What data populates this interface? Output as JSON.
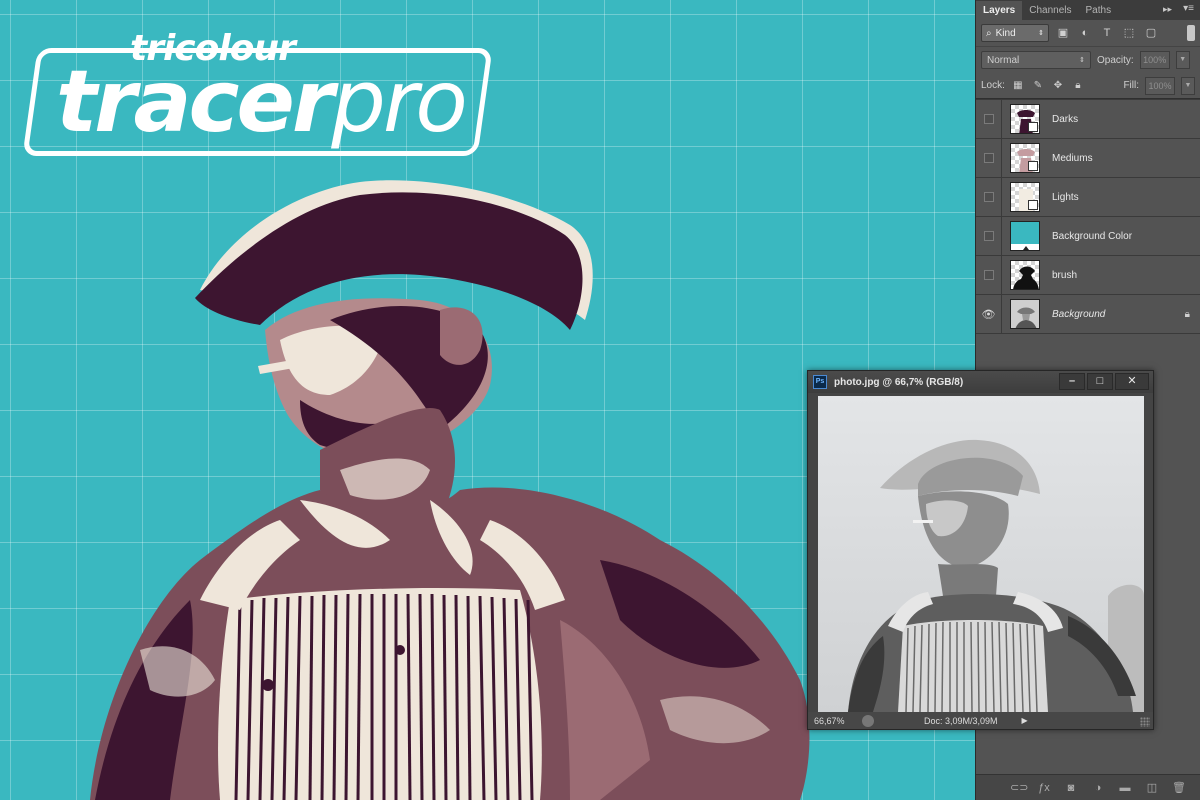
{
  "logo": {
    "top_text": "tricolour",
    "main_bold": "tracer",
    "main_light": "pro"
  },
  "colors": {
    "background": "#3ab8c0",
    "dark": "#3d1530",
    "medium": "#9b6b73",
    "light": "#efe6da"
  },
  "panel": {
    "tabs": [
      "Layers",
      "Channels",
      "Paths"
    ],
    "active_tab": "Layers",
    "filter_kind": "Kind",
    "blend_mode": "Normal",
    "opacity_label": "Opacity:",
    "opacity_value": "100%",
    "lock_label": "Lock:",
    "fill_label": "Fill:",
    "fill_value": "100%",
    "layers": [
      {
        "name": "Darks",
        "visible": false
      },
      {
        "name": "Mediums",
        "visible": false
      },
      {
        "name": "Lights",
        "visible": false
      },
      {
        "name": "Background Color",
        "visible": false
      },
      {
        "name": "brush",
        "visible": false
      },
      {
        "name": "Background",
        "visible": true,
        "locked": true
      }
    ]
  },
  "document": {
    "title": "photo.jpg @ 66,7% (RGB/8)",
    "app_badge": "Ps",
    "zoom": "66,67%",
    "doc_info": "Doc: 3,09M/3,09M"
  }
}
